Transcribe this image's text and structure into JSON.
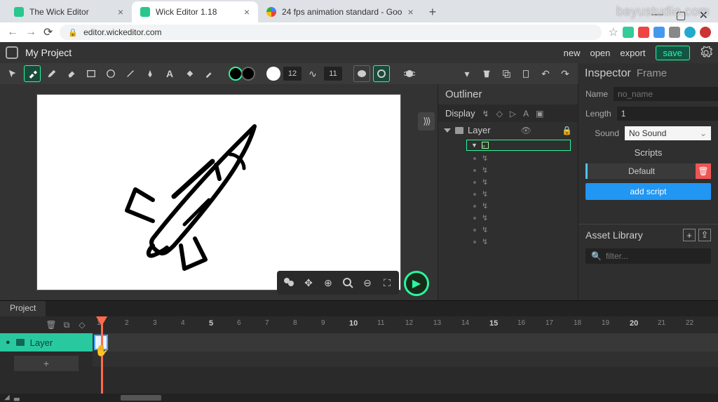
{
  "browser": {
    "tabs": [
      {
        "title": "The Wick Editor",
        "favicon": "wick"
      },
      {
        "title": "Wick Editor 1.18",
        "favicon": "wick",
        "active": true
      },
      {
        "title": "24 fps animation standard - Goo",
        "favicon": "google"
      }
    ],
    "url_host": "editor.wickeditor.com"
  },
  "watermark": "bayustudio.com",
  "header": {
    "project_title": "My Project",
    "links": {
      "new": "new",
      "open": "open",
      "export": "export",
      "save": "save"
    }
  },
  "toolbar": {
    "brush_size": "12",
    "stroke_w": "11"
  },
  "inspector": {
    "title": "Inspector",
    "subtitle": "Frame",
    "fields": {
      "name_label": "Name",
      "name_placeholder": "no_name",
      "length_label": "Length",
      "length_value": "1",
      "sound_label": "Sound",
      "sound_value": "No Sound"
    },
    "scripts": {
      "header": "Scripts",
      "default_label": "Default",
      "add_label": "add script"
    }
  },
  "outliner": {
    "title": "Outliner",
    "display_label": "Display",
    "layer_name": "Layer",
    "path_count": 8
  },
  "asset_lib": {
    "title": "Asset Library",
    "filter_placeholder": "filter..."
  },
  "timeline": {
    "tab": "Project",
    "layer_name": "Layer",
    "ticks": [
      {
        "n": 1
      },
      {
        "n": 2
      },
      {
        "n": 3
      },
      {
        "n": 4
      },
      {
        "n": 5,
        "major": true
      },
      {
        "n": 6
      },
      {
        "n": 7
      },
      {
        "n": 8
      },
      {
        "n": 9
      },
      {
        "n": 10,
        "major": true
      },
      {
        "n": 11
      },
      {
        "n": 12
      },
      {
        "n": 13
      },
      {
        "n": 14
      },
      {
        "n": 15,
        "major": true
      },
      {
        "n": 16
      },
      {
        "n": 17
      },
      {
        "n": 18
      },
      {
        "n": 19
      },
      {
        "n": 20,
        "major": true
      },
      {
        "n": 21
      },
      {
        "n": 22
      }
    ],
    "add_label": "+"
  }
}
